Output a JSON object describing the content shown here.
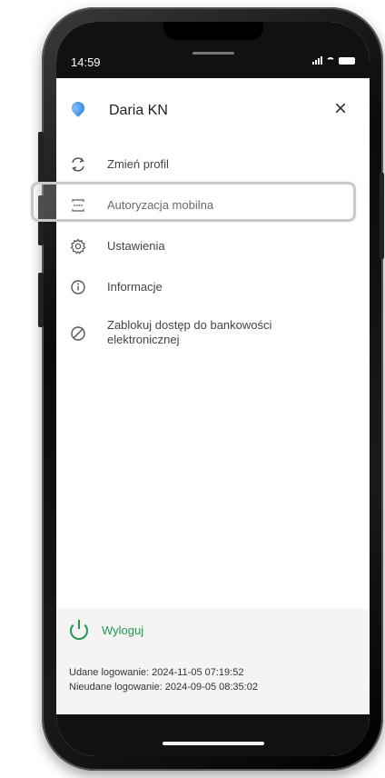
{
  "status_bar": {
    "time": "14:59"
  },
  "header": {
    "profile_name": "Daria KN",
    "close_glyph": "×"
  },
  "menu": {
    "items": [
      {
        "label": "Zmień profil",
        "icon": "refresh-icon"
      },
      {
        "label": "Autoryzacja mobilna",
        "icon": "mobile-auth-icon"
      },
      {
        "label": "Ustawienia",
        "icon": "gear-icon"
      },
      {
        "label": "Informacje",
        "icon": "info-icon"
      },
      {
        "label": "Zablokuj dostęp do bankowości elektronicznej",
        "icon": "block-icon"
      }
    ]
  },
  "footer": {
    "logout_label": "Wyloguj",
    "successful_login": "Udane logowanie: 2024-11-05 07:19:52",
    "failed_login": "Nieudane logowanie: 2024-09-05 08:35:02"
  },
  "colors": {
    "accent": "#1d9a4f",
    "avatar": "#1e78d6"
  }
}
